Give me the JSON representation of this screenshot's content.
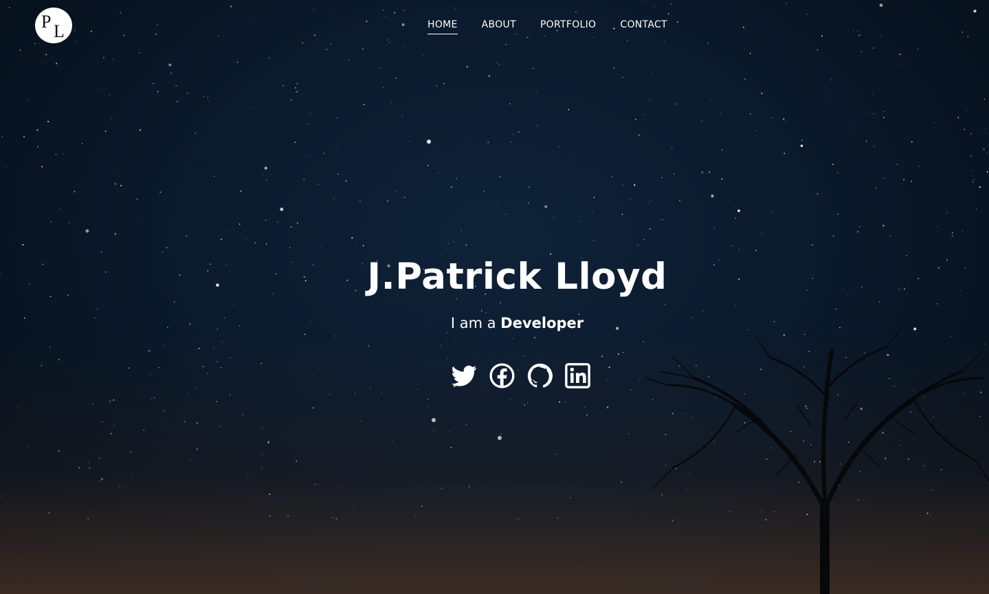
{
  "brand": {
    "logo_letters": [
      "P",
      "L"
    ]
  },
  "nav": {
    "items": [
      {
        "label": "HOME",
        "active": true
      },
      {
        "label": "ABOUT",
        "active": false
      },
      {
        "label": "PORTFOLIO",
        "active": false
      },
      {
        "label": "CONTACT",
        "active": false
      }
    ]
  },
  "hero": {
    "name": "J.Patrick Lloyd",
    "subtitle_prefix": "I am a",
    "subtitle_role": "Developer"
  },
  "social": [
    {
      "icon": "twitter-icon"
    },
    {
      "icon": "facebook-icon"
    },
    {
      "icon": "github-icon"
    },
    {
      "icon": "linkedin-icon"
    }
  ],
  "colors": {
    "text": "#ffffff",
    "background": "#0b1a2c"
  }
}
